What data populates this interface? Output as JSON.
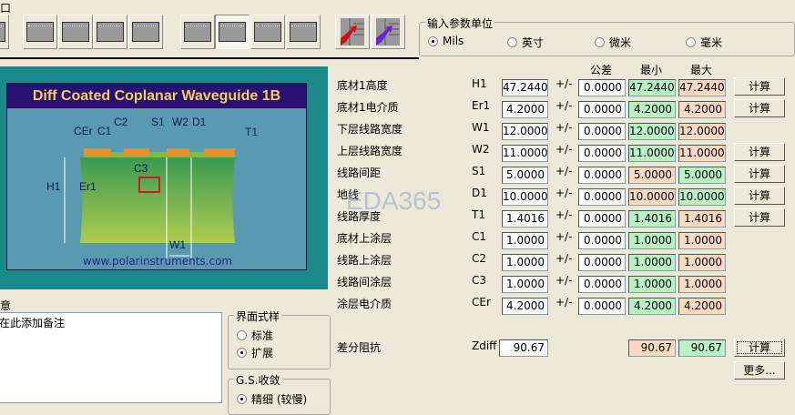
{
  "window": {
    "clipped_top_label": "口"
  },
  "toolbar": {
    "buttons": [
      "structure-1",
      "structure-2",
      "structure-3",
      "structure-4",
      "structure-5",
      "structure-6",
      "structure-7",
      "structure-8",
      "structure-9",
      "structure-10"
    ],
    "actions": [
      "export-red",
      "export-purple"
    ]
  },
  "units": {
    "title": "输入参数单位",
    "options": [
      "Mils",
      "英寸",
      "微米",
      "毫米"
    ],
    "selected": "Mils"
  },
  "diagram": {
    "title": "Diff Coated Coplanar Waveguide 1B",
    "url": "www.polarinstruments.com",
    "labels": {
      "cer": "CEr",
      "c1": "C1",
      "c2": "C2",
      "s1": "S1",
      "w2": "W2",
      "d1": "D1",
      "t1": "T1",
      "c3": "C3",
      "h1": "H1",
      "er1": "Er1",
      "w1": "W1"
    }
  },
  "headers": {
    "tolerance": "公差",
    "min": "最小",
    "max": "最大"
  },
  "params": [
    {
      "label": "底材1高度",
      "sym": "H1",
      "value": "47.2440",
      "tol": "0.0000",
      "min": "47.2440",
      "max": "47.2440",
      "minc": "g",
      "calc": "计算"
    },
    {
      "label": "底材1电介质",
      "sym": "Er1",
      "value": "4.2000",
      "tol": "0.0000",
      "min": "4.2000",
      "max": "4.2000",
      "minc": "g",
      "calc": "计算"
    },
    {
      "label": "下层线路宽度",
      "sym": "W1",
      "value": "12.0000",
      "tol": "0.0000",
      "min": "12.0000",
      "max": "12.0000",
      "minc": "g"
    },
    {
      "label": "上层线路宽度",
      "sym": "W2",
      "value": "11.0000",
      "tol": "0.0000",
      "min": "11.0000",
      "max": "11.0000",
      "minc": "g",
      "calc": "计算"
    },
    {
      "label": "线路间距",
      "sym": "S1",
      "value": "5.0000",
      "tol": "0.0000",
      "min": "5.0000",
      "max": "5.0000",
      "minc": "o",
      "calc": "计算"
    },
    {
      "label": "地线",
      "sym": "D1",
      "value": "10.0000",
      "tol": "0.0000",
      "min": "10.0000",
      "max": "10.0000",
      "minc": "o",
      "calc": "计算"
    },
    {
      "label": "线路厚度",
      "sym": "T1",
      "value": "1.4016",
      "tol": "0.0000",
      "min": "1.4016",
      "max": "1.4016",
      "minc": "g",
      "calc": "计算"
    },
    {
      "label": "底材上涂层",
      "sym": "C1",
      "value": "1.0000",
      "tol": "0.0000",
      "min": "1.0000",
      "max": "1.0000",
      "minc": "g"
    },
    {
      "label": "线路上涂层",
      "sym": "C2",
      "value": "1.0000",
      "tol": "0.0000",
      "min": "1.0000",
      "max": "1.0000",
      "minc": "g"
    },
    {
      "label": "线路间涂层",
      "sym": "C3",
      "value": "1.0000",
      "tol": "0.0000",
      "min": "1.0000",
      "max": "1.0000",
      "minc": "g"
    },
    {
      "label": "涂层电介质",
      "sym": "CEr",
      "value": "4.2000",
      "tol": "0.0000",
      "min": "4.2000",
      "max": "4.2000",
      "minc": "g"
    }
  ],
  "pm": "+/-",
  "result": {
    "label": "差分阻抗",
    "sym": "Zdiff",
    "value": "90.67",
    "min": "90.67",
    "max": "90.67",
    "calc": "计算",
    "more": "更多..."
  },
  "notes": {
    "label": "意",
    "placeholder": "在此添加备注"
  },
  "style_group": {
    "title": "界面式样",
    "options": [
      "标准",
      "扩展"
    ],
    "selected": "扩展"
  },
  "gs_group": {
    "title": "G.S.收敛",
    "options": [
      "精细 (较慢)"
    ],
    "selected": "精细 (较慢)"
  },
  "watermark": "EDA365",
  "colors": {
    "green": "#b9f2c4",
    "orange": "#fad9c4",
    "teal": "#1a8a8a",
    "navy": "#2a1070",
    "title": "#f0d060"
  }
}
